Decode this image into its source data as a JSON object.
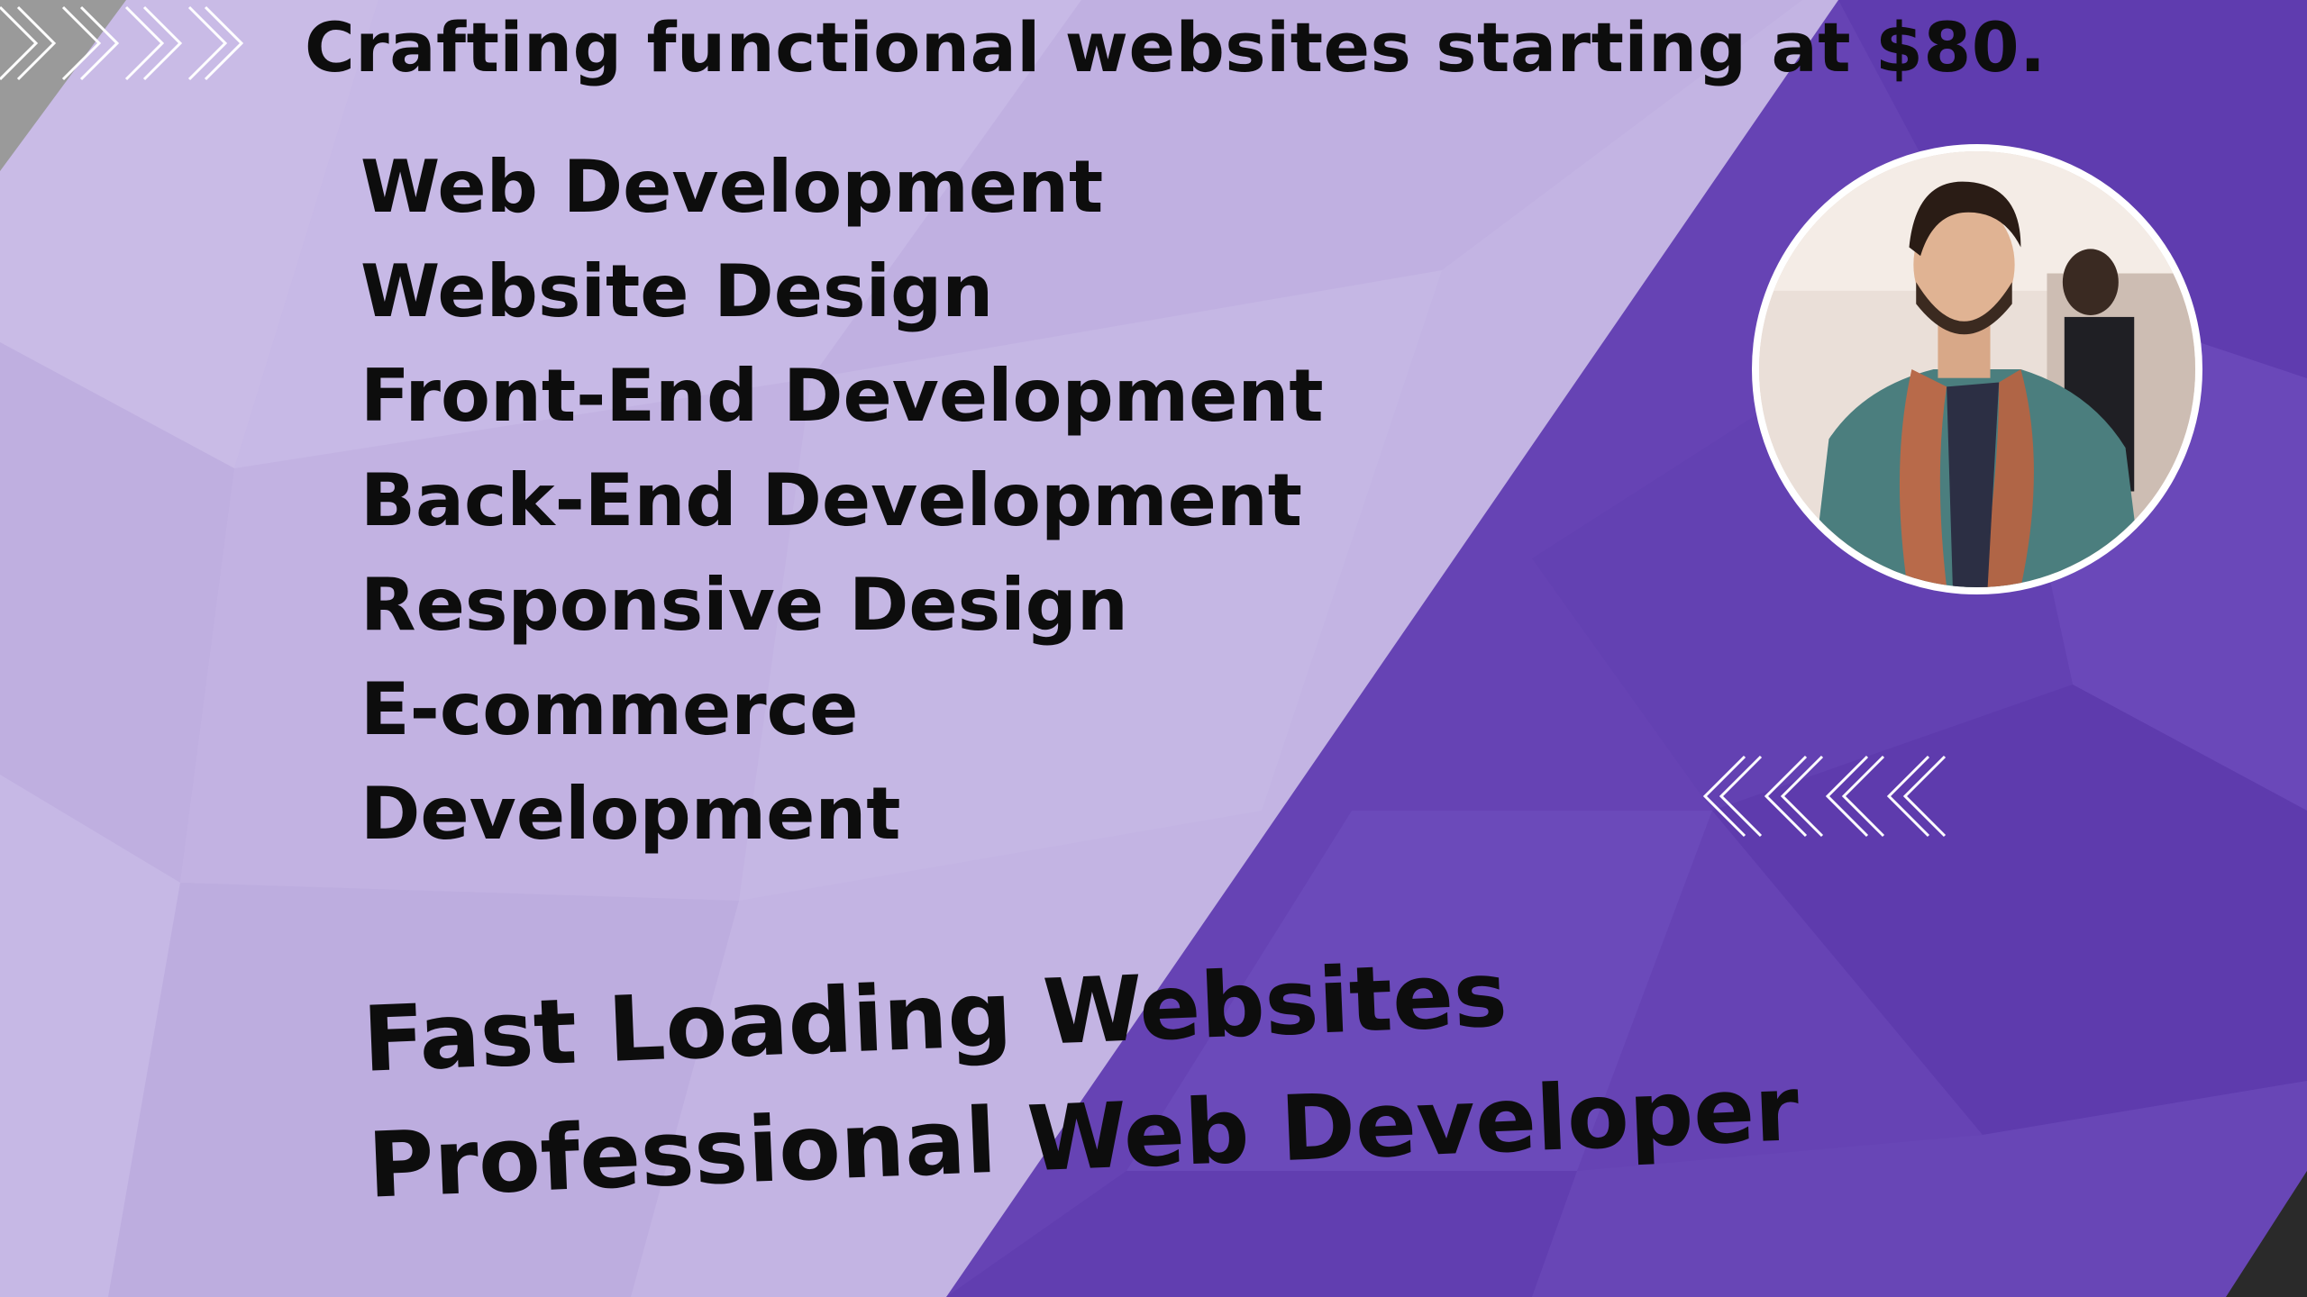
{
  "headline": "Crafting functional websites starting at $80.",
  "services": [
    "Web Development",
    "Website Design",
    "Front-End Development",
    "Back-End Development",
    "Responsive Design",
    "E-commerce",
    "Development"
  ],
  "taglines": {
    "line1": "Fast Loading Websites",
    "line2": "Professional Web Developer"
  },
  "colors": {
    "lavender": "#c4b5e4",
    "purple": "#6a45b8",
    "text": "#0d0d0d",
    "chevron": "#ffffff"
  },
  "icons": {
    "top_chevrons": "double-chevron-right-icon",
    "right_chevrons": "double-chevron-left-icon",
    "avatar": "profile-photo"
  }
}
